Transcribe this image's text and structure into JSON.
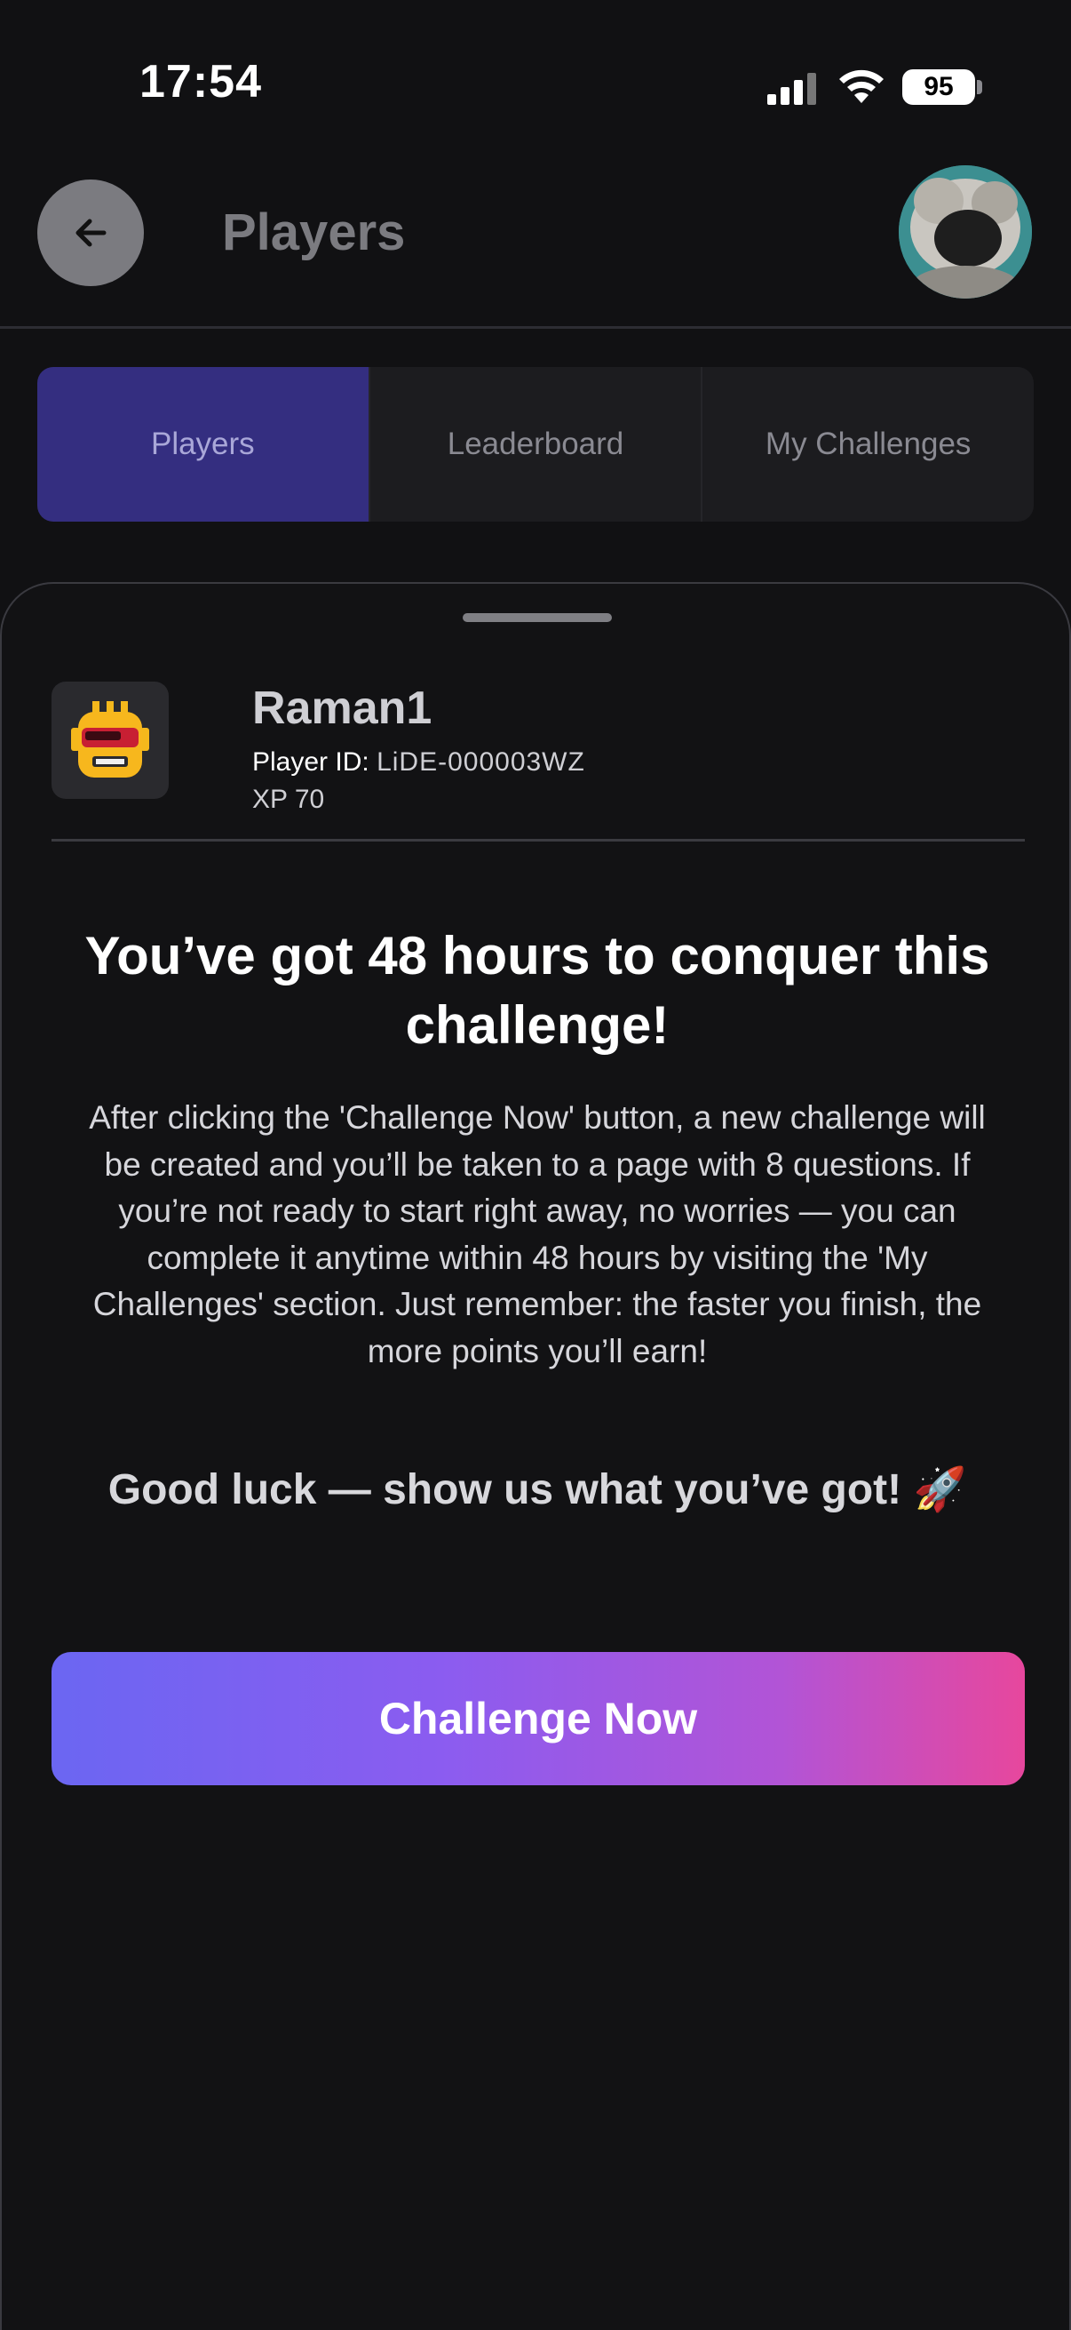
{
  "status_bar": {
    "time": "17:54",
    "battery": "95"
  },
  "header": {
    "title": "Players",
    "back_icon": "arrow-left-icon",
    "avatar_icon": "profile-photo"
  },
  "tabs": [
    {
      "label": "Players",
      "active": true
    },
    {
      "label": "Leaderboard",
      "active": false
    },
    {
      "label": "My Challenges",
      "active": false
    }
  ],
  "player": {
    "name": "Raman1",
    "id_label": "Player ID:",
    "id_value": "LiDE-000003WZ",
    "xp": "XP 70",
    "avatar_icon": "robot-icon"
  },
  "challenge": {
    "headline": "You’ve got 48 hours to conquer this challenge!",
    "body": "After clicking the 'Challenge Now' button, a new challenge will be created and you’ll be taken to a page with 8 questions. If you’re not ready to start right away, no worries — you can complete it anytime within 48 hours by visiting the 'My Challenges' section. Just remember: the faster you finish, the more points you’ll earn!",
    "good_luck": "Good luck — show us what you’ve got! 🚀",
    "button_label": "Challenge Now"
  },
  "colors": {
    "accent": "#342e80",
    "gradient_start": "#6b66f2",
    "gradient_end": "#e7479d",
    "background": "#111113"
  }
}
